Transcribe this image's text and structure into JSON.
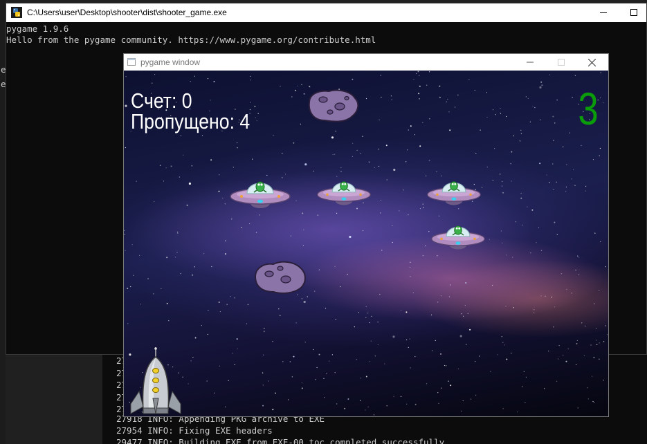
{
  "background_terminal": {
    "lines": [
      "27",
      "27",
      "27",
      "27",
      "27",
      "27918 INFO: Appending PKG archive to EXE",
      "27954 INFO: Fixing EXE headers",
      "29477 INFO: Building EXE from EXE-00.toc completed successfully."
    ]
  },
  "console": {
    "title": "C:\\Users\\user\\Desktop\\shooter\\dist\\shooter_game.exe",
    "lines": [
      "pygame 1.9.6",
      "Hello from the pygame community. https://www.pygame.org/contribute.html"
    ],
    "stub_chars": [
      "e",
      "e"
    ]
  },
  "pygame_window": {
    "title": "pygame window"
  },
  "game": {
    "score_text": "Счет: 0",
    "missed_text": "Пропущено: 4",
    "lives": "3",
    "lives_color": "#0a9c0a",
    "sprites": {
      "enemies": 4,
      "asteroids": 2,
      "player": "rocket"
    }
  }
}
